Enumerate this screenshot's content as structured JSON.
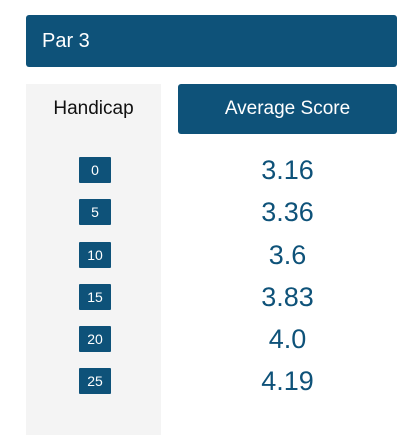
{
  "header": {
    "title": "Par 3"
  },
  "table": {
    "handicap_label": "Handicap",
    "average_label": "Average Score",
    "rows": [
      {
        "handicap": "0",
        "score": "3.16"
      },
      {
        "handicap": "5",
        "score": "3.36"
      },
      {
        "handicap": "10",
        "score": "3.6"
      },
      {
        "handicap": "15",
        "score": "3.83"
      },
      {
        "handicap": "20",
        "score": "4.0"
      },
      {
        "handicap": "25",
        "score": "4.19"
      }
    ]
  },
  "colors": {
    "accent": "#0e5279",
    "panel_bg": "#f4f4f4"
  }
}
